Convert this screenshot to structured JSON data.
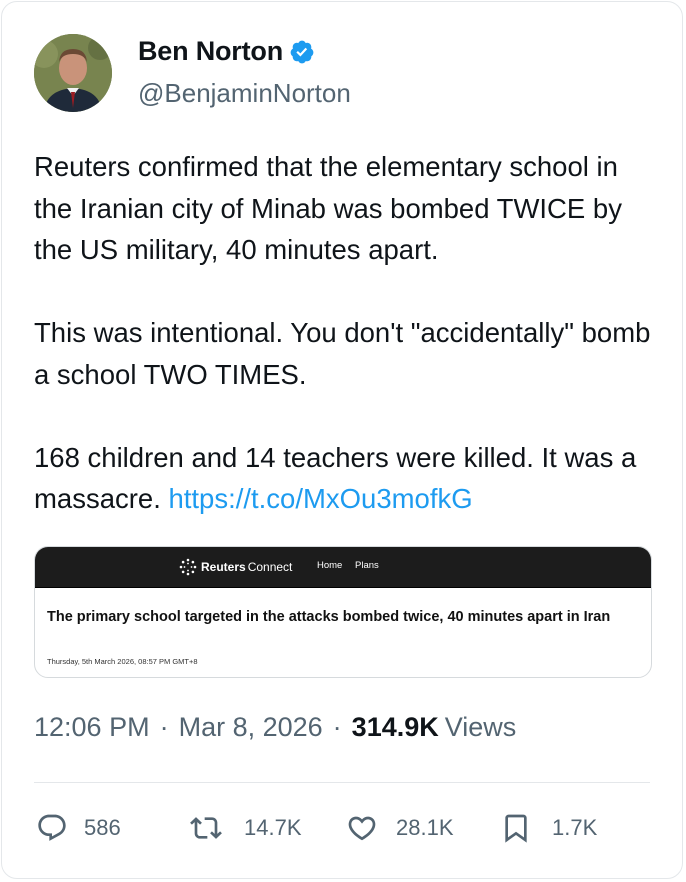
{
  "author": {
    "display_name": "Ben Norton",
    "handle": "@BenjaminNorton",
    "verified": true
  },
  "tweet": {
    "paragraph1": "Reuters confirmed that the elementary school in the Iranian city of Minab was bombed TWICE by the US military, 40 minutes apart.",
    "paragraph2": "This was intentional. You don't \"accidentally\" bomb a school TWO TIMES.",
    "paragraph3_text": "168 children and 14 teachers were killed. It was a massacre. ",
    "paragraph3_link": "https://t.co/MxOu3mofkG"
  },
  "embed": {
    "brand_strong": "Reuters",
    "brand_light": "Connect",
    "nav_home": "Home",
    "nav_plans": "Plans",
    "headline": "The primary school targeted in the attacks bombed twice, 40 minutes apart in Iran",
    "date": "Thursday, 5th March 2026, 08:57 PM GMT+8"
  },
  "meta": {
    "time": "12:06 PM",
    "separator": "·",
    "date": "Mar 8, 2026",
    "views_count": "314.9K",
    "views_label": "Views"
  },
  "actions": {
    "replies": "586",
    "reposts": "14.7K",
    "likes": "28.1K",
    "bookmarks": "1.7K"
  },
  "colors": {
    "link": "#1d9bf0",
    "verified": "#1d9bf0",
    "muted": "#536471",
    "text": "#0f1419"
  },
  "icons": [
    "verified-badge-icon",
    "reply-icon",
    "repost-icon",
    "like-icon",
    "bookmark-icon",
    "reuters-logo-icon"
  ]
}
